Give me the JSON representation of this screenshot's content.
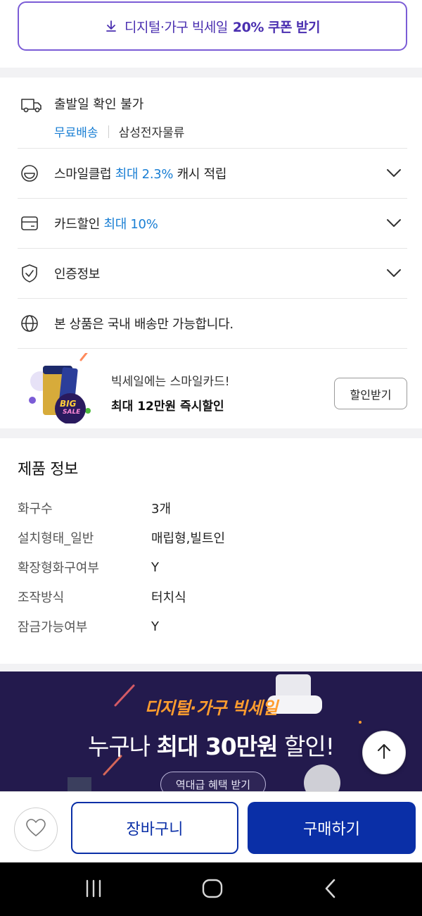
{
  "coupon": {
    "label_prefix": "디지털·가구 빅세일",
    "label_bold": "20% 쿠폰 받기",
    "icon": "download-icon"
  },
  "shipping": {
    "icon": "truck-icon",
    "status": "출발일 확인 불가",
    "free_label": "무료배송",
    "carrier": "삼성전자물류"
  },
  "smile_club": {
    "icon": "smile-icon",
    "prefix": "스마일클럽",
    "highlight": "최대 2.3%",
    "suffix": "캐시 적립"
  },
  "card_discount": {
    "icon": "card-icon",
    "prefix": "카드할인",
    "highlight": "최대 10%"
  },
  "certification": {
    "icon": "shield-check-icon",
    "label": "인증정보"
  },
  "domestic": {
    "icon": "globe-icon",
    "label": "본 상품은 국내 배송만 가능합니다."
  },
  "promo": {
    "line1": "빅세일에는 스마일카드!",
    "line2": "최대 12만원 즉시할인",
    "button": "할인받기",
    "badge_line1": "BIG",
    "badge_line2": "SALE"
  },
  "spec": {
    "title": "제품 정보",
    "rows": [
      {
        "key": "화구수",
        "value": "3개"
      },
      {
        "key": "설치형태_일반",
        "value": "매립형,빌트인"
      },
      {
        "key": "확장형화구여부",
        "value": "Y"
      },
      {
        "key": "조작방식",
        "value": "터치식"
      },
      {
        "key": "잠금가능여부",
        "value": "Y"
      }
    ]
  },
  "banner": {
    "title": "디지털·가구 빅세일",
    "sub_prefix": "누구나",
    "sub_bold": "최대 30만원",
    "sub_suffix": "할인!",
    "button": "역대급 혜택 받기"
  },
  "bottom": {
    "cart": "장바구니",
    "buy": "구매하기"
  },
  "colors": {
    "accent_purple": "#7b5cd6",
    "link_blue": "#1a7fd4",
    "primary_navy": "#0a2fa7",
    "banner_bg": "#231a4d"
  }
}
